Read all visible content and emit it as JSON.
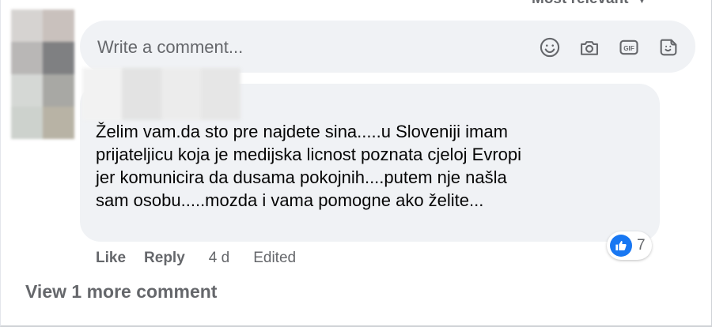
{
  "sort": {
    "label": "Most relevant"
  },
  "composer": {
    "placeholder": "Write a comment...",
    "tools": [
      {
        "icon": "emoji-icon"
      },
      {
        "icon": "camera-icon"
      },
      {
        "icon": "gif-icon"
      },
      {
        "icon": "sticker-icon"
      }
    ]
  },
  "comment": {
    "text": "Želim vam.da sto pre najdete sina.....u Sloveniji imam\nprijateljicu koja je medijska licnost poznata cjeloj Evropi\njer komunicira da dusama pokojnih....putem nje našla\nsam osobu.....mozda i vama pomogne ako želite...",
    "reactions": {
      "icon": "like-icon",
      "count": "7",
      "color": "#1877f2"
    },
    "actions": {
      "like": "Like",
      "reply": "Reply",
      "time": "4 d",
      "edited": "Edited"
    }
  },
  "view_more": {
    "label": "View 1 more comment"
  }
}
